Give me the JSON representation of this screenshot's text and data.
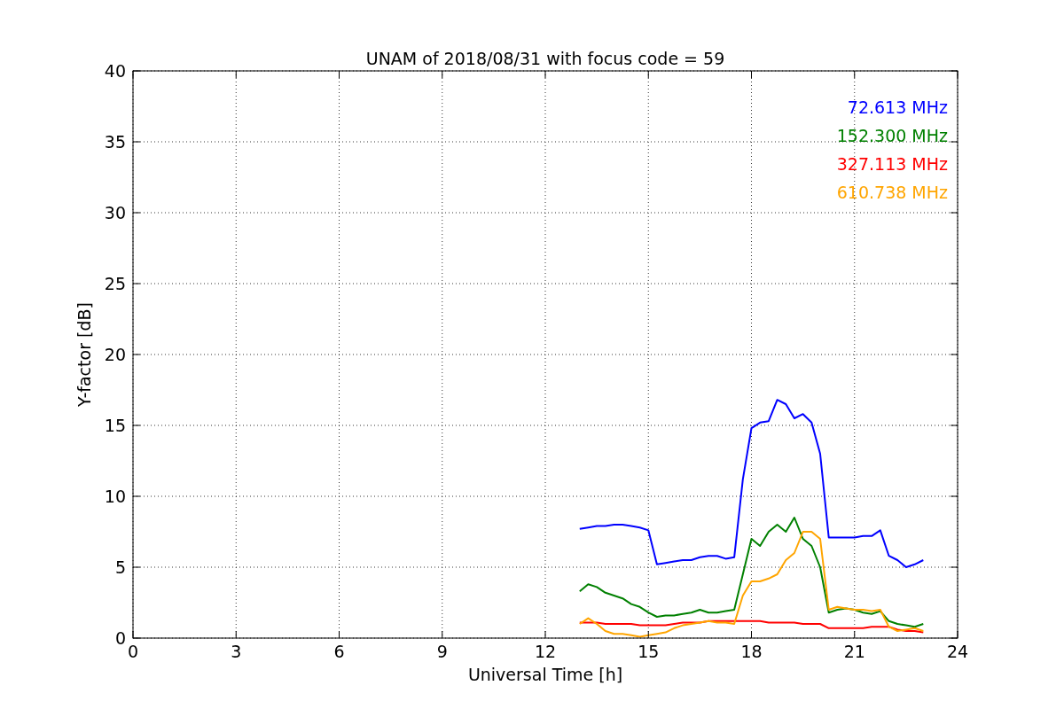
{
  "chart": {
    "chart_data": {
      "type": "line",
      "grid": true,
      "title": "UNAM of 2018/08/31 with focus code = 59",
      "xlabel": "Universal Time [h]",
      "ylabel": "Y-factor [dB]",
      "xlim": [
        0,
        24
      ],
      "ylim": [
        0,
        40
      ],
      "xticks": [
        0,
        3,
        6,
        9,
        12,
        15,
        18,
        21,
        24
      ],
      "yticks": [
        0,
        5,
        10,
        15,
        20,
        25,
        30,
        35,
        40
      ],
      "x": [
        13,
        13.25,
        13.5,
        13.75,
        14,
        14.25,
        14.5,
        14.75,
        15,
        15.25,
        15.5,
        15.75,
        16,
        16.25,
        16.5,
        16.75,
        17,
        17.25,
        17.5,
        17.75,
        18,
        18.25,
        18.5,
        18.75,
        19,
        19.25,
        19.5,
        19.75,
        20,
        20.25,
        20.5,
        20.75,
        21,
        21.25,
        21.5,
        21.75,
        22,
        22.25,
        22.5,
        22.75,
        23
      ],
      "series": [
        {
          "name": "72.613 MHz",
          "color": "#0000ff",
          "values": [
            7.7,
            7.8,
            7.9,
            7.9,
            8.0,
            8.0,
            7.9,
            7.8,
            7.6,
            5.2,
            5.3,
            5.4,
            5.5,
            5.5,
            5.7,
            5.8,
            5.8,
            5.6,
            5.7,
            11.2,
            14.8,
            15.2,
            15.3,
            16.8,
            16.5,
            15.5,
            15.8,
            15.2,
            13.0,
            7.1,
            7.1,
            7.1,
            7.1,
            7.2,
            7.2,
            7.6,
            5.8,
            5.5,
            5.0,
            5.2,
            5.5
          ]
        },
        {
          "name": "152.300 MHz",
          "color": "#008000",
          "values": [
            3.3,
            3.8,
            3.6,
            3.2,
            3.0,
            2.8,
            2.4,
            2.2,
            1.8,
            1.5,
            1.6,
            1.6,
            1.7,
            1.8,
            2.0,
            1.8,
            1.8,
            1.9,
            2.0,
            4.5,
            7.0,
            6.5,
            7.5,
            8.0,
            7.5,
            8.5,
            7.0,
            6.5,
            5.0,
            1.8,
            2.0,
            2.1,
            2.0,
            1.8,
            1.7,
            1.9,
            1.2,
            1.0,
            0.9,
            0.8,
            1.0
          ]
        },
        {
          "name": "327.113 MHz",
          "color": "#ff0000",
          "values": [
            1.1,
            1.1,
            1.1,
            1.0,
            1.0,
            1.0,
            1.0,
            0.9,
            0.9,
            0.9,
            0.9,
            1.0,
            1.1,
            1.1,
            1.1,
            1.2,
            1.2,
            1.2,
            1.2,
            1.2,
            1.2,
            1.2,
            1.1,
            1.1,
            1.1,
            1.1,
            1.0,
            1.0,
            1.0,
            0.7,
            0.7,
            0.7,
            0.7,
            0.7,
            0.8,
            0.8,
            0.8,
            0.6,
            0.5,
            0.5,
            0.4
          ]
        },
        {
          "name": "610.738 MHz",
          "color": "#ffa500",
          "values": [
            1.0,
            1.4,
            1.0,
            0.5,
            0.3,
            0.3,
            0.2,
            0.1,
            0.2,
            0.3,
            0.4,
            0.7,
            0.9,
            1.0,
            1.1,
            1.2,
            1.1,
            1.1,
            1.0,
            3.0,
            4.0,
            4.0,
            4.2,
            4.5,
            5.5,
            6.0,
            7.5,
            7.5,
            7.0,
            2.0,
            2.2,
            2.1,
            2.0,
            2.0,
            1.9,
            2.0,
            0.8,
            0.5,
            0.6,
            0.7,
            0.5
          ]
        }
      ]
    }
  }
}
